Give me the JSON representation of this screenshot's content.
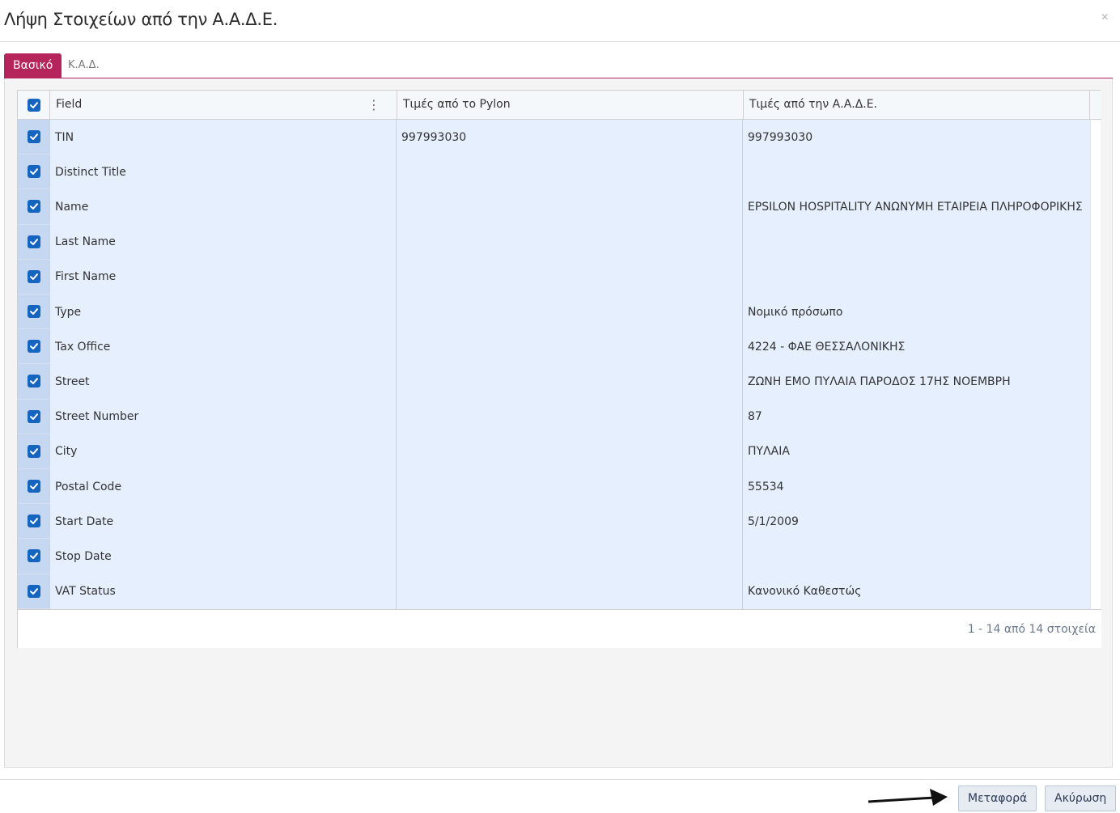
{
  "dialog": {
    "title": "Λήψη Στοιχείων από την Α.Α.Δ.Ε.",
    "close_label": "×"
  },
  "tabs": [
    {
      "label": "Βασικό",
      "active": true
    },
    {
      "label": "Κ.Α.Δ.",
      "active": false
    }
  ],
  "grid": {
    "columns": {
      "field": "Field",
      "pylon": "Τιμές από το Pylon",
      "aade": "Τιμές από την Α.Α.Δ.Ε."
    },
    "column_menu_icon": "⋮",
    "rows": [
      {
        "field": "TIN",
        "pylon": "997993030",
        "aade": "997993030",
        "checked": true
      },
      {
        "field": "Distinct Title",
        "pylon": "",
        "aade": "",
        "checked": true
      },
      {
        "field": "Name",
        "pylon": "",
        "aade": "EPSILON HOSPITALITY ΑΝΩΝΥΜΗ ΕΤΑΙΡΕΙΑ ΠΛΗΡΟΦΟΡΙΚΗΣ",
        "checked": true
      },
      {
        "field": "Last Name",
        "pylon": "",
        "aade": "",
        "checked": true
      },
      {
        "field": "First Name",
        "pylon": "",
        "aade": "",
        "checked": true
      },
      {
        "field": "Type",
        "pylon": "",
        "aade": "Νομικό πρόσωπο",
        "checked": true
      },
      {
        "field": "Tax Office",
        "pylon": "",
        "aade": "4224 - ΦΑΕ ΘΕΣΣΑΛΟΝΙΚΗΣ",
        "checked": true
      },
      {
        "field": "Street",
        "pylon": "",
        "aade": "ΖΩΝΗ ΕΜΟ ΠΥΛΑΙΑ ΠΑΡΟΔΟΣ 17ΗΣ ΝΟΕΜΒΡΗ",
        "checked": true
      },
      {
        "field": "Street Number",
        "pylon": "",
        "aade": "87",
        "checked": true
      },
      {
        "field": "City",
        "pylon": "",
        "aade": "ΠΥΛΑΙΑ",
        "checked": true
      },
      {
        "field": "Postal Code",
        "pylon": "",
        "aade": "55534",
        "checked": true
      },
      {
        "field": "Start Date",
        "pylon": "",
        "aade": "5/1/2009",
        "checked": true
      },
      {
        "field": "Stop Date",
        "pylon": "",
        "aade": "",
        "checked": true
      },
      {
        "field": "VAT Status",
        "pylon": "",
        "aade": "Κανονικό Καθεστώς",
        "checked": true
      }
    ],
    "pager_info": "1 - 14 από 14 στοιχεία"
  },
  "footer": {
    "transfer_label": "Μεταφορά",
    "cancel_label": "Ακύρωση"
  },
  "colors": {
    "accent": "#b6245c",
    "checkbox": "#1565c0",
    "row_selected": "#e6effd"
  }
}
